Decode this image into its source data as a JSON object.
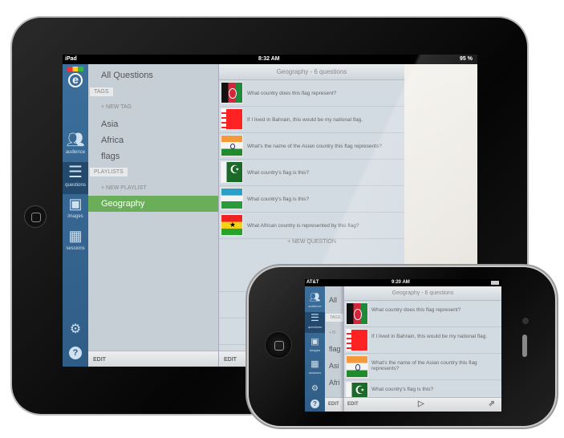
{
  "ipad": {
    "status": {
      "carrier": "iPad",
      "time": "8:32 AM",
      "battery": "95 %"
    },
    "rail": [
      {
        "label": "audience",
        "icon": "people-icon"
      },
      {
        "label": "questions",
        "icon": "list-icon",
        "active": true
      },
      {
        "label": "images",
        "icon": "images-icon"
      },
      {
        "label": "sessions",
        "icon": "calendar-icon"
      }
    ],
    "menu": {
      "all_questions": "All Questions",
      "tags_label": "TAGS",
      "new_tag": "+ NEW TAG",
      "tags": [
        "Asia",
        "Africa",
        "flags"
      ],
      "playlists_label": "PLAYLISTS",
      "new_playlist": "+ NEW PLAYLIST",
      "selected_playlist": "Geography",
      "edit": "EDIT"
    },
    "list": {
      "header": "Geography - 6 questions",
      "questions": [
        {
          "flag": "afghanistan",
          "text": "What country does this flag represent?"
        },
        {
          "flag": "bahrain",
          "text": "If I lived in Bahrain, this would be my national flag."
        },
        {
          "flag": "india",
          "text": "What's the name of the Asian country this flag represents?"
        },
        {
          "flag": "pakistan",
          "text": "What country's flag is this?"
        },
        {
          "flag": "uzbekistan",
          "text": "What country's flag is this?"
        },
        {
          "flag": "ghana",
          "text": "What African country is represented by this flag?"
        }
      ],
      "new_question": "+ NEW QUESTION",
      "edit": "EDIT"
    }
  },
  "iphone": {
    "status": {
      "carrier": "AT&T",
      "time": "9:20 AM"
    },
    "rail": [
      {
        "label": "audience"
      },
      {
        "label": "questions",
        "active": true
      },
      {
        "label": "images"
      },
      {
        "label": "sessions"
      }
    ],
    "menu": {
      "all_questions": "All",
      "tags_label": "TAGS",
      "new_tag": "+ N",
      "tags": [
        "flag",
        "Asi",
        "Afri"
      ],
      "edit": "EDIT"
    },
    "list": {
      "header": "Geography - 6 questions",
      "questions": [
        {
          "text": "What country does this flag represent?"
        },
        {
          "text": "If I lived in Bahrain, this would be my national flag."
        },
        {
          "text": "What's the name of the Asian country this flag represents?"
        },
        {
          "text": "What country's flag is this?"
        }
      ],
      "edit": "EDIT"
    }
  },
  "colors": {
    "rail": "#3c6f9c",
    "selected": "#6aae5a",
    "menu_bg": "#c6ced6",
    "list_bg": "#d3dbe2"
  }
}
